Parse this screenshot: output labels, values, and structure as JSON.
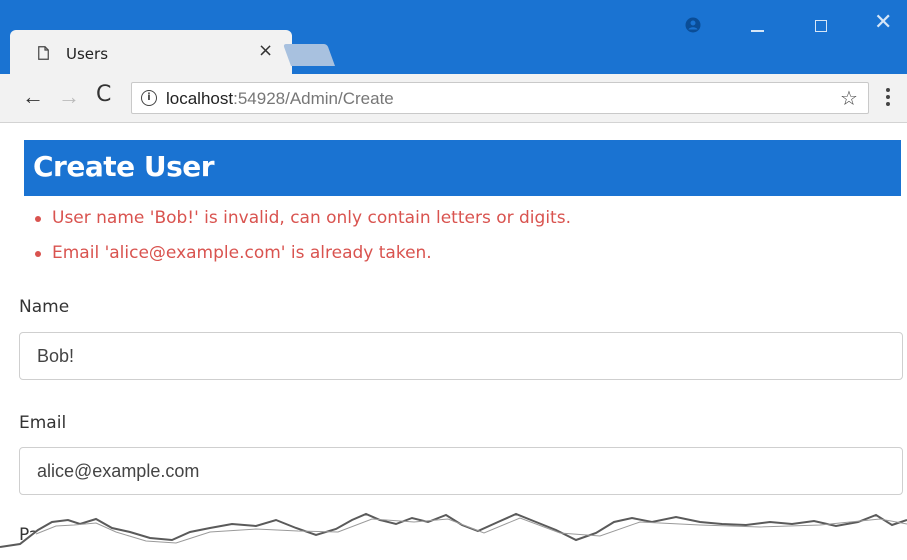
{
  "browser": {
    "tab_title": "Users",
    "tab_close": "×",
    "address_host": "localhost",
    "address_path": ":54928/Admin/Create",
    "window_close": "✕",
    "star": "☆"
  },
  "page": {
    "title": "Create User",
    "errors": [
      "User name 'Bob!' is invalid, can only contain letters or digits.",
      "Email 'alice@example.com' is already taken."
    ],
    "form": {
      "name_label": "Name",
      "name_value": "Bob!",
      "email_label": "Email",
      "email_value": "alice@example.com",
      "password_label_partial": "Pa"
    }
  },
  "icons": {
    "tab": "page-icon",
    "back": "back-arrow-icon",
    "forward": "forward-arrow-icon",
    "reload": "reload-icon",
    "info": "info-icon",
    "bookmark": "star-icon",
    "menu": "more-vertical-icon",
    "account": "account-icon"
  },
  "colors": {
    "chrome_blue": "#1a73d2",
    "header_blue": "#1a73d2",
    "error_red": "#d9534f"
  }
}
